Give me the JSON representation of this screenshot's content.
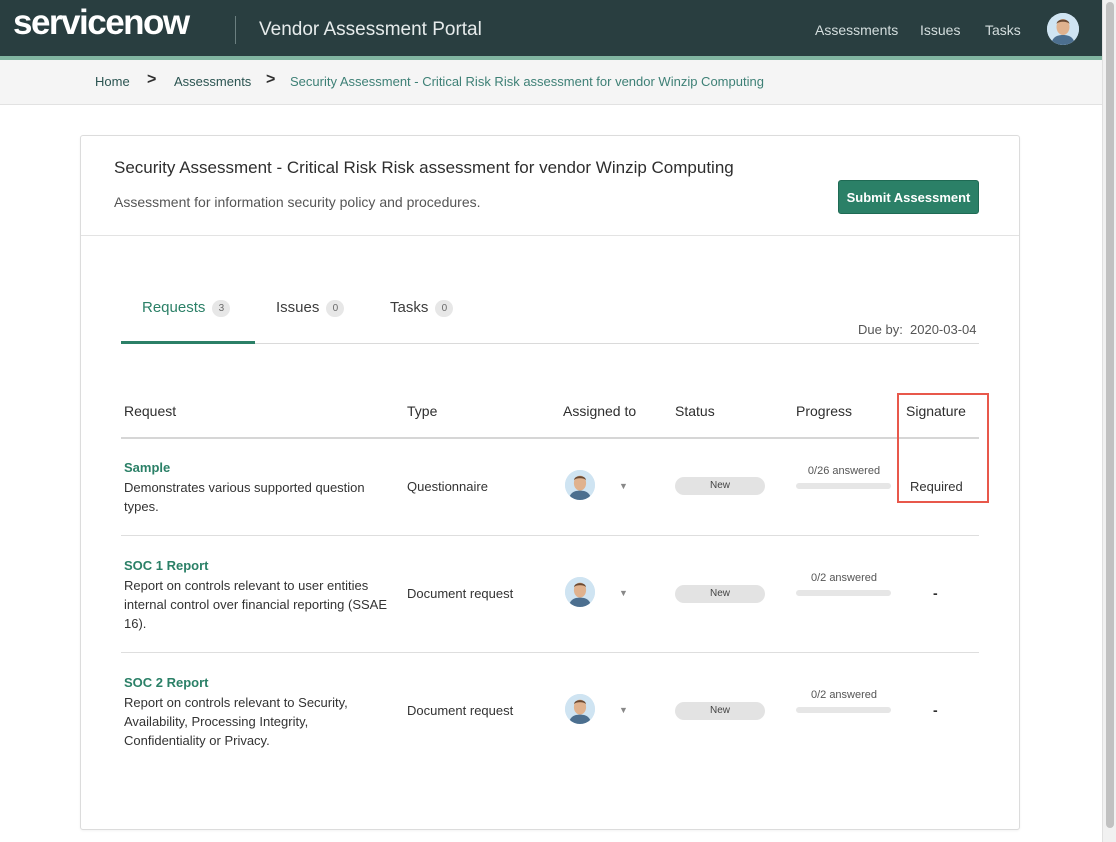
{
  "header": {
    "logo_text": "servicenow",
    "logo_trademark": ".",
    "portal_title": "Vendor Assessment Portal",
    "nav": [
      "Assessments",
      "Issues",
      "Tasks"
    ]
  },
  "breadcrumb": {
    "items": [
      "Home",
      "Assessments",
      "Security Assessment - Critical Risk Risk assessment for vendor Winzip Computing"
    ],
    "separator": ">"
  },
  "assessment": {
    "title": "Security Assessment - Critical Risk Risk assessment for vendor Winzip Computing",
    "subtitle": "Assessment for information security policy and procedures.",
    "submit_label": "Submit Assessment",
    "due_label": "Due by:",
    "due_date": "2020-03-04"
  },
  "tabs": [
    {
      "label": "Requests",
      "count": "3",
      "active": true
    },
    {
      "label": "Issues",
      "count": "0",
      "active": false
    },
    {
      "label": "Tasks",
      "count": "0",
      "active": false
    }
  ],
  "table": {
    "columns": [
      "Request",
      "Type",
      "Assigned to",
      "Status",
      "Progress",
      "Signature"
    ],
    "rows": [
      {
        "name": "Sample",
        "description": "Demonstrates various supported question types.",
        "type": "Questionnaire",
        "status": "New",
        "progress_text": "0/26 answered",
        "progress_fraction": 0,
        "signature": "Required"
      },
      {
        "name": "SOC 1 Report",
        "description": "Report on controls relevant to user entities internal control over financial reporting (SSAE 16).",
        "type": "Document request",
        "status": "New",
        "progress_text": "0/2 answered",
        "progress_fraction": 0,
        "signature": "-"
      },
      {
        "name": "SOC 2 Report",
        "description": "Report on controls relevant to Security, Availability, Processing Integrity, Confidentiality or Privacy.",
        "type": "Document request",
        "status": "New",
        "progress_text": "0/2 answered",
        "progress_fraction": 0,
        "signature": "-"
      }
    ]
  },
  "colors": {
    "header_bg": "#293e40",
    "accent_green": "#2b8067",
    "header_stripe": "#81b5a1",
    "highlight": "#e8584b"
  }
}
